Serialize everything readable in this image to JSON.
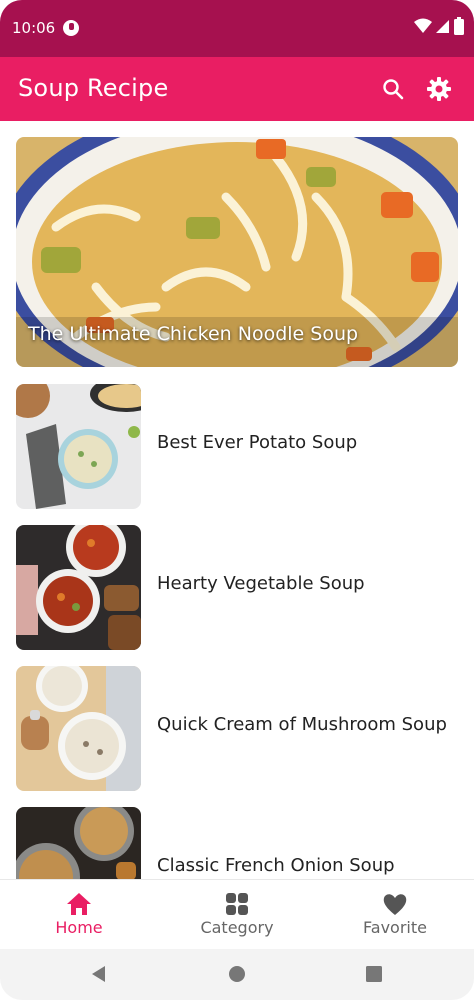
{
  "status_bar": {
    "time": "10:06"
  },
  "app_bar": {
    "title": "Soup Recipe",
    "actions": [
      "search-icon",
      "gear-icon"
    ]
  },
  "featured": {
    "title": "The Ultimate Chicken Noodle Soup"
  },
  "recipes": [
    {
      "title": "Best Ever Potato Soup"
    },
    {
      "title": "Hearty Vegetable Soup"
    },
    {
      "title": "Quick Cream of Mushroom Soup"
    },
    {
      "title": "Classic French Onion Soup"
    }
  ],
  "bottom_nav": {
    "items": [
      {
        "label": "Home",
        "icon": "home-icon",
        "active": true
      },
      {
        "label": "Category",
        "icon": "grid-icon",
        "active": false
      },
      {
        "label": "Favorite",
        "icon": "heart-icon",
        "active": false
      }
    ]
  },
  "colors": {
    "status_bar": "#a6114f",
    "app_bar": "#e91e63",
    "active_nav": "#e91e63"
  }
}
